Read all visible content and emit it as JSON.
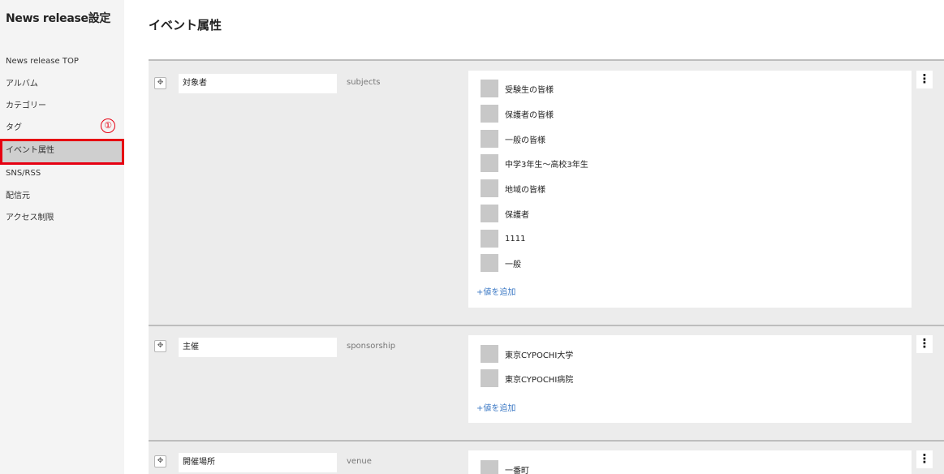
{
  "sidebar": {
    "title": "News release設定",
    "items": [
      {
        "label": "News release TOP"
      },
      {
        "label": "アルバム"
      },
      {
        "label": "カテゴリー"
      },
      {
        "label": "タグ"
      },
      {
        "label": "イベント属性"
      },
      {
        "label": "SNS/RSS"
      },
      {
        "label": "配信元"
      },
      {
        "label": "アクセス制限"
      }
    ],
    "annotation": "①"
  },
  "main": {
    "title": "イベント属性",
    "add_value_label": "+値を追加",
    "attributes": [
      {
        "name": "対象者",
        "key": "subjects",
        "values": [
          "受験生の皆様",
          "保護者の皆様",
          "一般の皆様",
          "中学3年生～高校3年生",
          "地域の皆様",
          "保護者",
          "1111",
          "一般"
        ]
      },
      {
        "name": "主催",
        "key": "sponsorship",
        "values": [
          "東京CYPOCHI大学",
          "東京CYPOCHI病院"
        ]
      },
      {
        "name": "開催場所",
        "key": "venue",
        "values": [
          "一番町"
        ]
      }
    ]
  },
  "icons": {
    "drag": "move-arrows-icon",
    "menu": "vertical-dots-icon"
  }
}
